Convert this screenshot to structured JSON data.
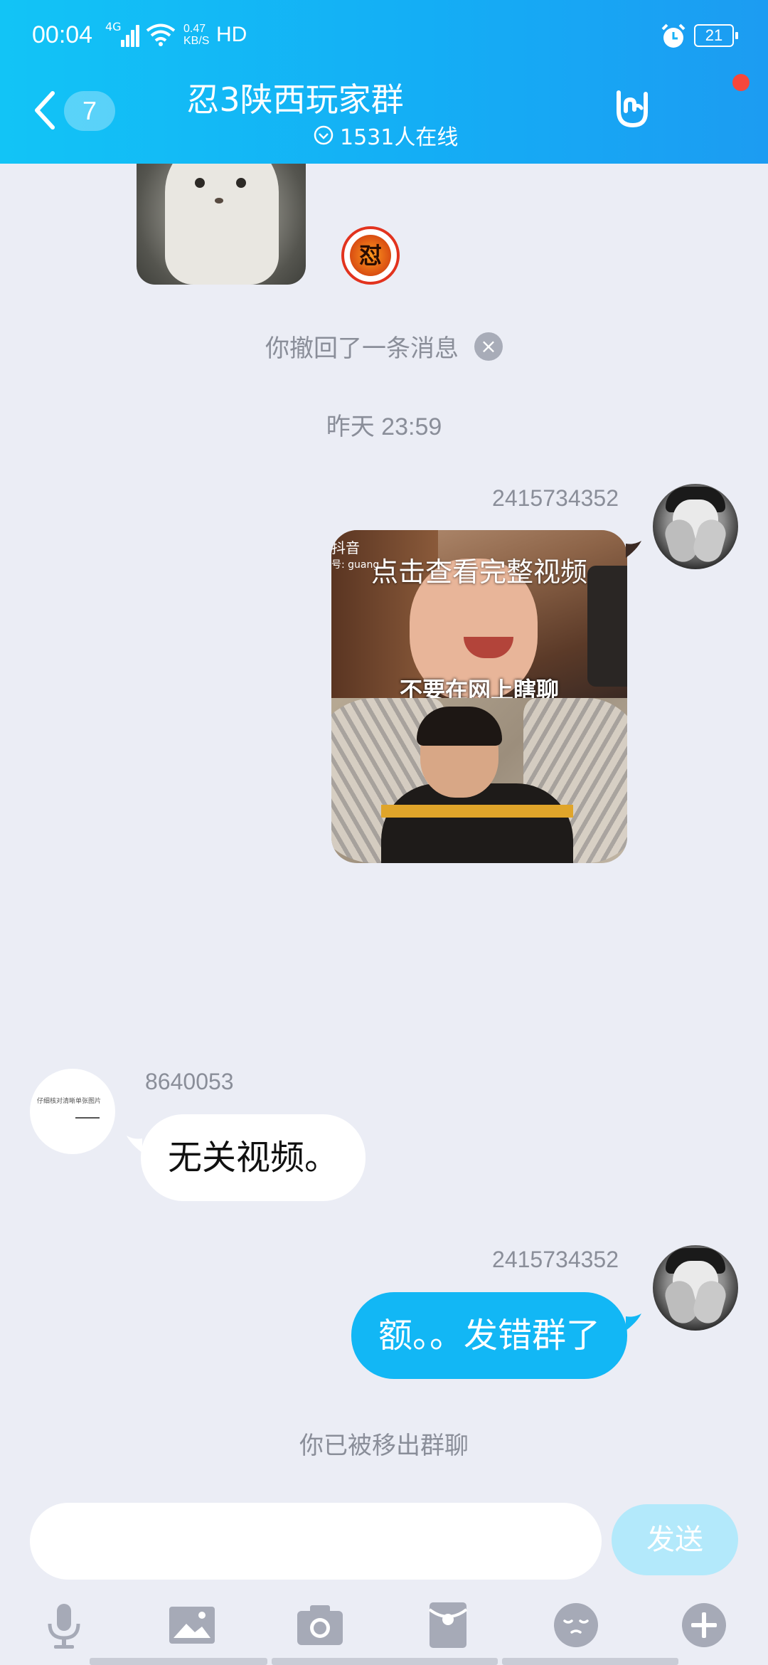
{
  "status_bar": {
    "time": "00:04",
    "network": "4G",
    "speed_value": "0.47",
    "speed_unit": "KB/S",
    "hd": "HD",
    "battery": "21"
  },
  "header": {
    "unread_count": "7",
    "title": "忍3陕西玩家群",
    "online": "1531人在线"
  },
  "chat": {
    "emblem_char": "怼",
    "recall_notice": "你撤回了一条消息",
    "timestamp": "昨天 23:59",
    "messages": [
      {
        "sender": "2415734352",
        "type": "video",
        "watermark_app": "抖音",
        "watermark_id": "号: guang",
        "overlay": "点击查看完整视频",
        "caption": "不要在网上瞎聊"
      },
      {
        "sender": "8640053",
        "type": "text",
        "text": "无关视频。"
      },
      {
        "sender": "2415734352",
        "type": "text",
        "text": "额。。发错群了"
      }
    ],
    "removed_notice": "你已被移出群聊"
  },
  "input": {
    "placeholder": "",
    "send_label": "发送"
  },
  "colors": {
    "header_start": "#12c4f6",
    "header_end": "#1c9cf2",
    "outgoing_bubble": "#12b7f5",
    "chat_background": "#ebedf5",
    "send_button": "#b3e9fb"
  },
  "icons": [
    "back-chevron-icon",
    "rock-hand-icon",
    "close-icon",
    "mic-icon",
    "image-icon",
    "camera-icon",
    "red-packet-icon",
    "emoji-icon",
    "plus-icon"
  ]
}
